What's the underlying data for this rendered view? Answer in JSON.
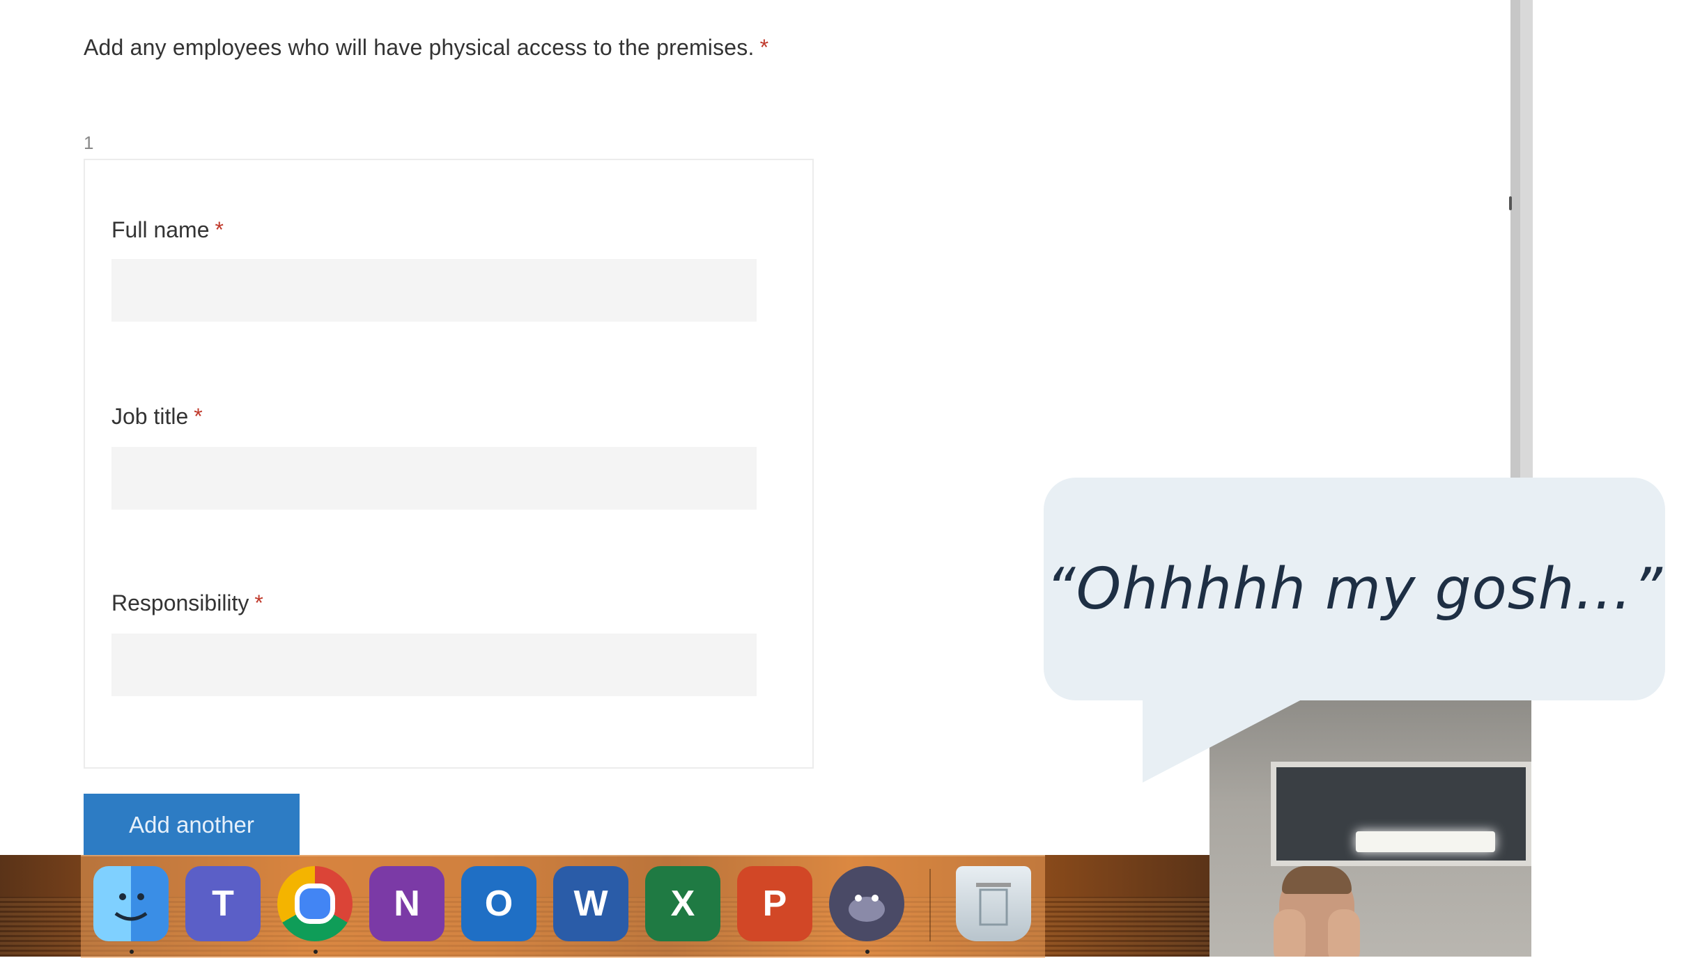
{
  "form": {
    "question": "Add any employees who will have physical access to the premises.",
    "required_mark": "*",
    "entry_number": "1",
    "fields": [
      {
        "label": "Full name",
        "required_mark": "*",
        "value": ""
      },
      {
        "label": "Job title",
        "required_mark": "*",
        "value": ""
      },
      {
        "label": "Responsibility",
        "required_mark": "*",
        "value": ""
      }
    ],
    "add_another_label": "Add another"
  },
  "dock": {
    "apps": [
      {
        "name": "finder-icon",
        "glyph": ""
      },
      {
        "name": "teams-icon",
        "glyph": "T"
      },
      {
        "name": "chrome-icon",
        "glyph": ""
      },
      {
        "name": "onenote-icon",
        "glyph": "N"
      },
      {
        "name": "outlook-icon",
        "glyph": "O"
      },
      {
        "name": "word-icon",
        "glyph": "W"
      },
      {
        "name": "excel-icon",
        "glyph": "X"
      },
      {
        "name": "powerpoint-icon",
        "glyph": "P"
      },
      {
        "name": "gorilla-app-icon",
        "glyph": ""
      },
      {
        "name": "trash-icon",
        "glyph": ""
      }
    ],
    "colors": {
      "teams": "#5b5fc7",
      "onenote": "#7b3aa6",
      "outlook": "#1f6fc5",
      "word": "#2a5ca8",
      "excel": "#1f7a43",
      "powerpoint": "#d24726"
    }
  },
  "overlay": {
    "quote": "“Ohhhhh my gosh…”"
  },
  "colors": {
    "required": "#c0392b",
    "button": "#2d7cc4",
    "input_bg": "#f4f4f4",
    "bubble": "#e8eff4"
  }
}
